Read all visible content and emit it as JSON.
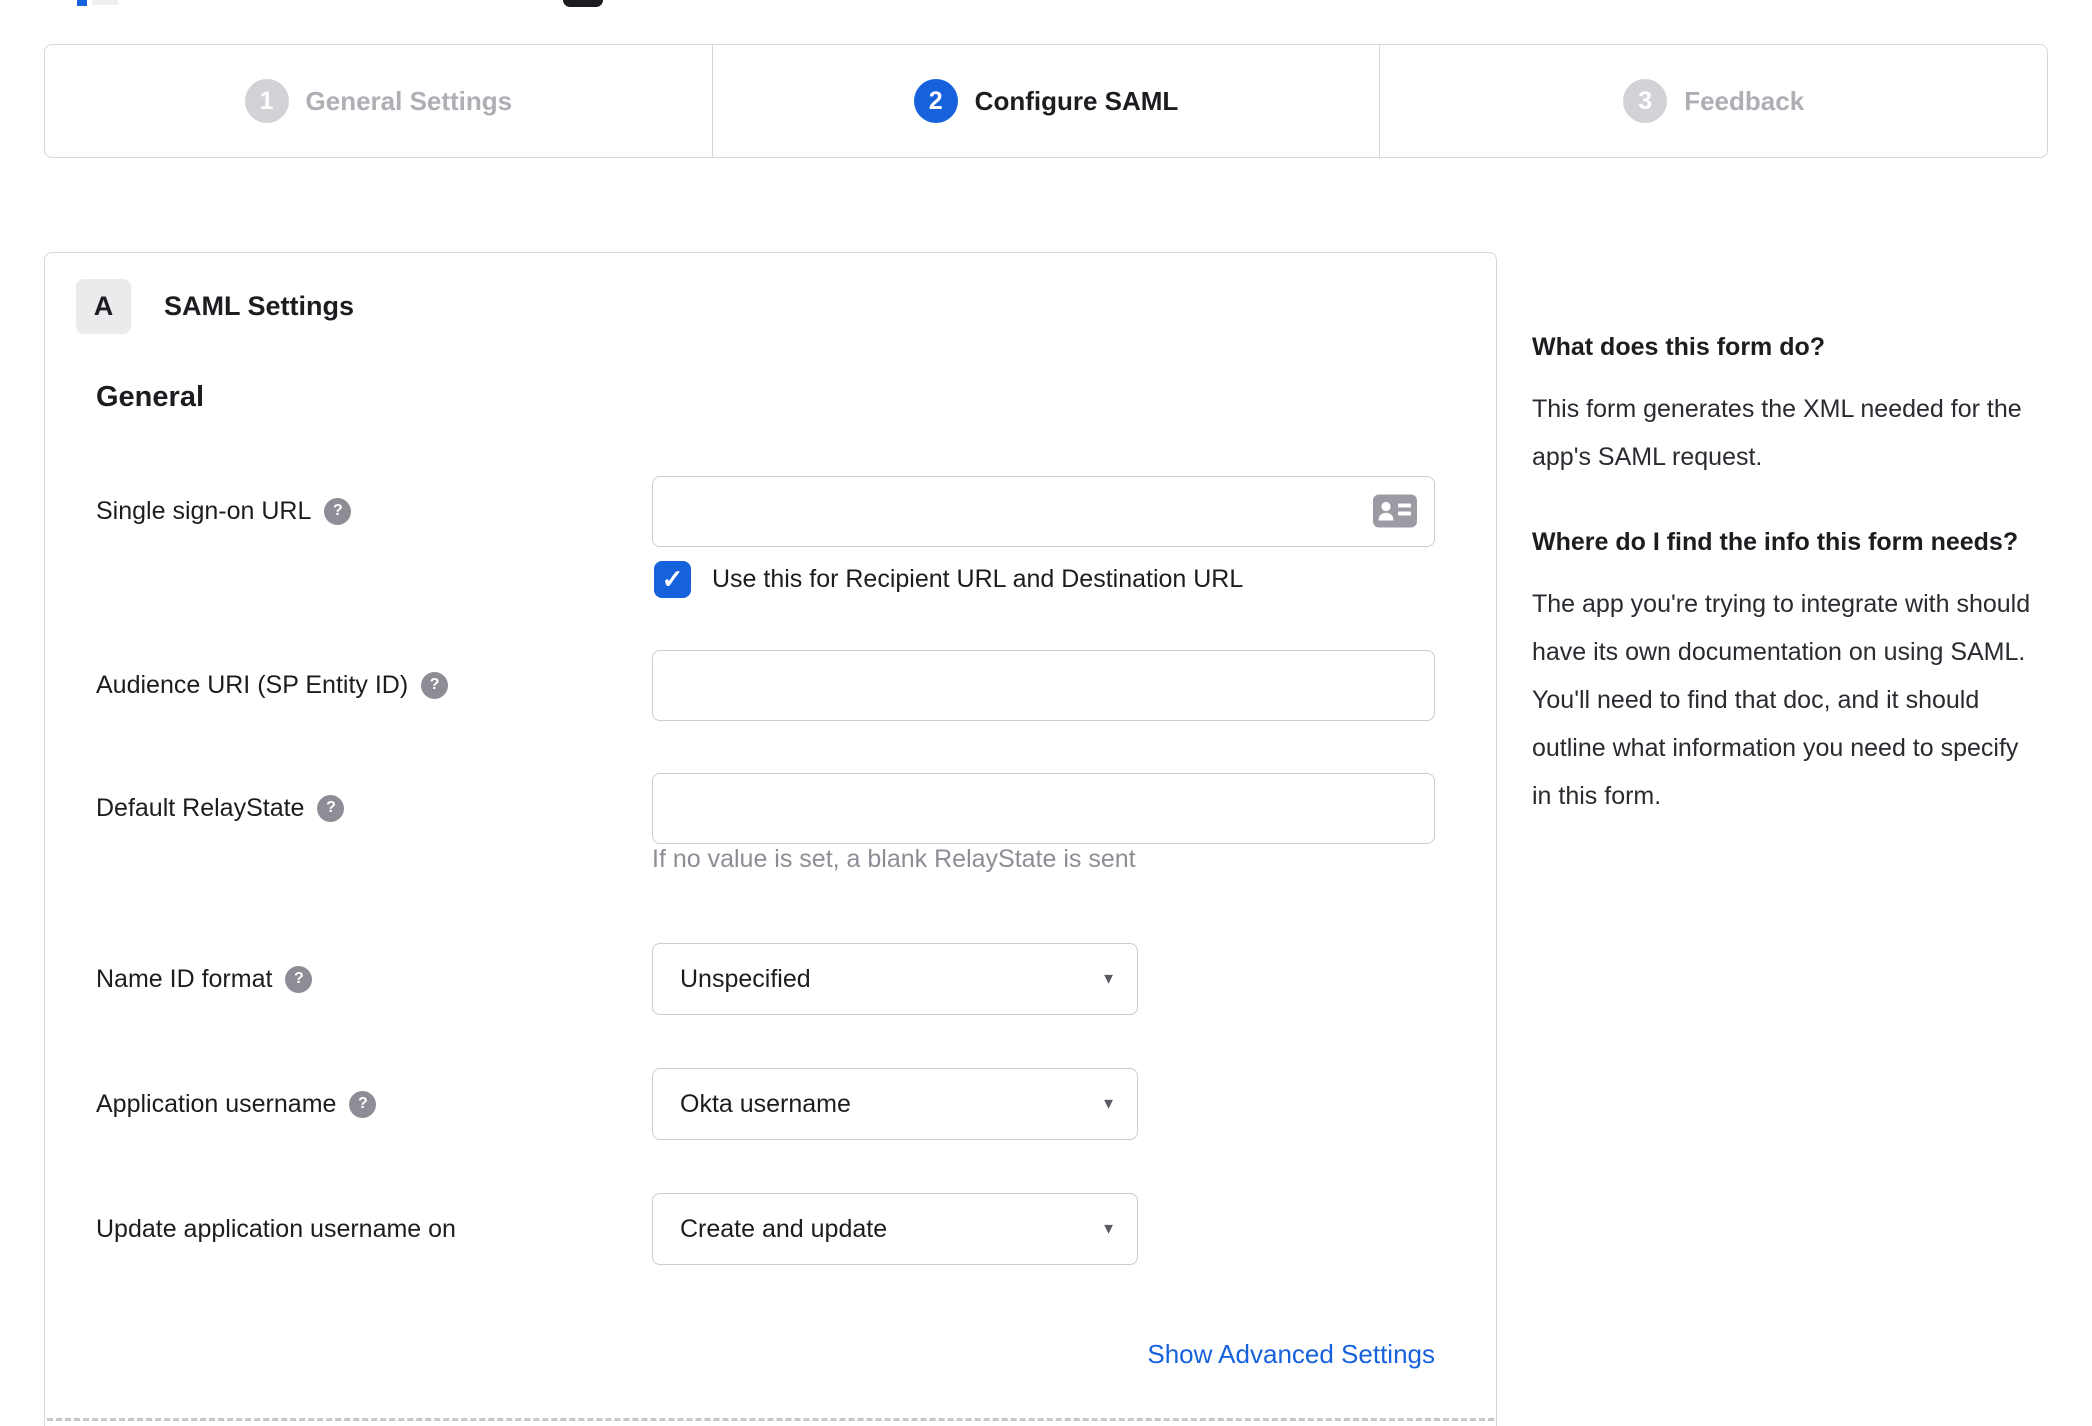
{
  "stepper": {
    "steps": [
      {
        "number": "1",
        "label": "General Settings",
        "state": "inactive"
      },
      {
        "number": "2",
        "label": "Configure SAML",
        "state": "active"
      },
      {
        "number": "3",
        "label": "Feedback",
        "state": "inactive"
      }
    ]
  },
  "panel": {
    "badge": "A",
    "title": "SAML Settings",
    "section_heading": "General",
    "fields": {
      "sso_url": {
        "label": "Single sign-on URL",
        "value": "",
        "has_help": true
      },
      "sso_checkbox": {
        "label": "Use this for Recipient URL and Destination URL",
        "checked": true
      },
      "audience": {
        "label": "Audience URI (SP Entity ID)",
        "value": "",
        "has_help": true
      },
      "relay_state": {
        "label": "Default RelayState",
        "value": "",
        "has_help": true,
        "hint": "If no value is set, a blank RelayState is sent"
      },
      "name_id": {
        "label": "Name ID format",
        "value": "Unspecified",
        "has_help": true
      },
      "app_username": {
        "label": "Application username",
        "value": "Okta username",
        "has_help": true
      },
      "update_username": {
        "label": "Update application username on",
        "value": "Create and update",
        "has_help": false
      }
    },
    "advanced_link": "Show Advanced Settings"
  },
  "sidebar": {
    "q1": "What does this form do?",
    "a1": "This form generates the XML needed for the app's SAML request.",
    "q2": "Where do I find the info this form needs?",
    "a2": "The app you're trying to integrate with should have its own documentation on using SAML. You'll need to find that doc, and it should outline what information you need to specify in this form."
  },
  "icons": {
    "help_glyph": "?",
    "check_glyph": "✓",
    "arrow_glyph": "▼",
    "contact_card": "contact-card-icon"
  },
  "colors": {
    "accent_blue": "#1662dd",
    "text_dark": "#1d1d21",
    "border_gray": "#d8d8dc",
    "input_border": "#cbcbd1",
    "muted_gray": "#8d8d95",
    "inactive_step": "#aeaeb5"
  }
}
